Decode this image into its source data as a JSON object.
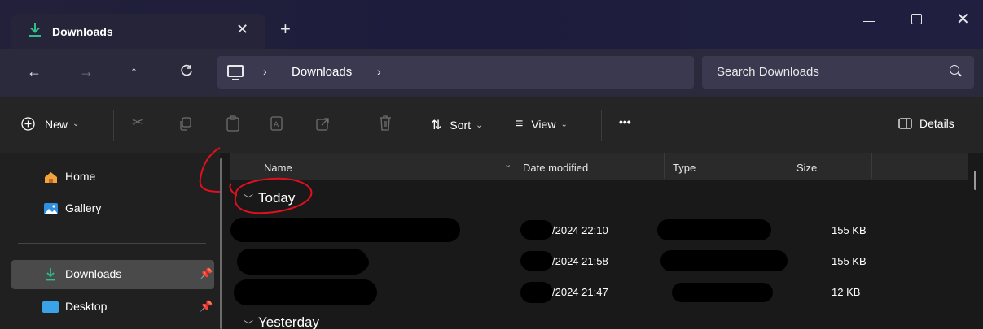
{
  "tab": {
    "title": "Downloads",
    "close": "✕",
    "new_tab": "+"
  },
  "window": {
    "minimize": "",
    "maximize": "",
    "close": "✕"
  },
  "nav": {
    "back": "←",
    "forward": "→",
    "up": "↑",
    "refresh": "C"
  },
  "address": {
    "separator": "›",
    "crumb": "Downloads"
  },
  "search": {
    "placeholder": "Search Downloads"
  },
  "commandbar": {
    "new_label": "New",
    "sort_label": "Sort",
    "view_label": "View",
    "more_label": "•••",
    "details_label": "Details"
  },
  "sidebar": {
    "items": [
      {
        "label": "Home"
      },
      {
        "label": "Gallery"
      },
      {
        "label": "Downloads"
      },
      {
        "label": "Desktop"
      }
    ]
  },
  "columns": {
    "name": "Name",
    "date": "Date modified",
    "type": "Type",
    "size": "Size"
  },
  "groups": [
    {
      "title": "Today",
      "rows": [
        {
          "date": "/2024 22:10",
          "size": "155 KB"
        },
        {
          "date": "/2024 21:58",
          "size": "155 KB"
        },
        {
          "date": "/2024 21:47",
          "size": "12 KB"
        }
      ]
    },
    {
      "title": "Yesterday"
    }
  ],
  "colors": {
    "accent": "#2ebf8a",
    "selected": "#4a4a4a",
    "annotation": "#e0101e"
  }
}
